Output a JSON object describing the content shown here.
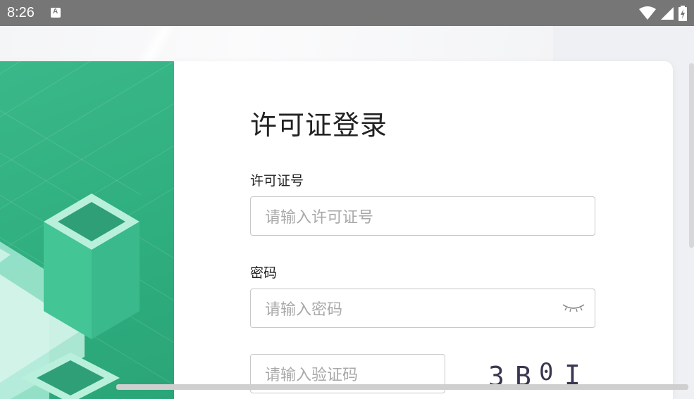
{
  "status_bar": {
    "time": "8:26",
    "icons": [
      "notification-a-icon",
      "wifi-icon",
      "signal-icon",
      "battery-charging-icon"
    ]
  },
  "login": {
    "title": "许可证登录",
    "license_label": "许可证号",
    "license_placeholder": "请输入许可证号",
    "password_label": "密码",
    "password_placeholder": "请输入密码",
    "captcha_placeholder": "请输入验证码",
    "captcha_text": [
      "3",
      "B",
      "0",
      "I"
    ]
  },
  "colors": {
    "accent": "#2fae7f",
    "text": "#222222",
    "placeholder": "#a9a9a9",
    "border": "#c8c8c8"
  }
}
